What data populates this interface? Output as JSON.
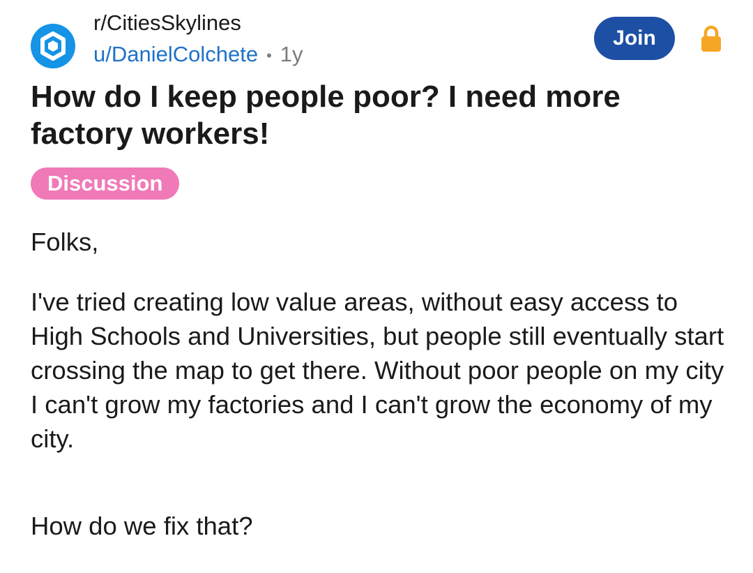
{
  "post": {
    "community": {
      "name": "r/CitiesSkylines",
      "icon": "cities-skylines-hexagon-logo",
      "icon_color": "#1593e6"
    },
    "author": "u/DanielColchete",
    "separator": "•",
    "age": "1y",
    "join_label": "Join",
    "join_color": "#1d4fa4",
    "lock_icon": "padlock-icon",
    "lock_color": "#f5a623",
    "title": "How do I keep people poor? I need more factory workers!",
    "flair": {
      "label": "Discussion",
      "color": "#f079b8"
    },
    "body": [
      "Folks,",
      "I've tried creating low value areas, without easy access to High Schools and Universities, but people still eventually start crossing the map to get there. Without poor people on my city I can't grow my factories and I can't grow the economy of my city.",
      "How do we fix that?"
    ]
  }
}
